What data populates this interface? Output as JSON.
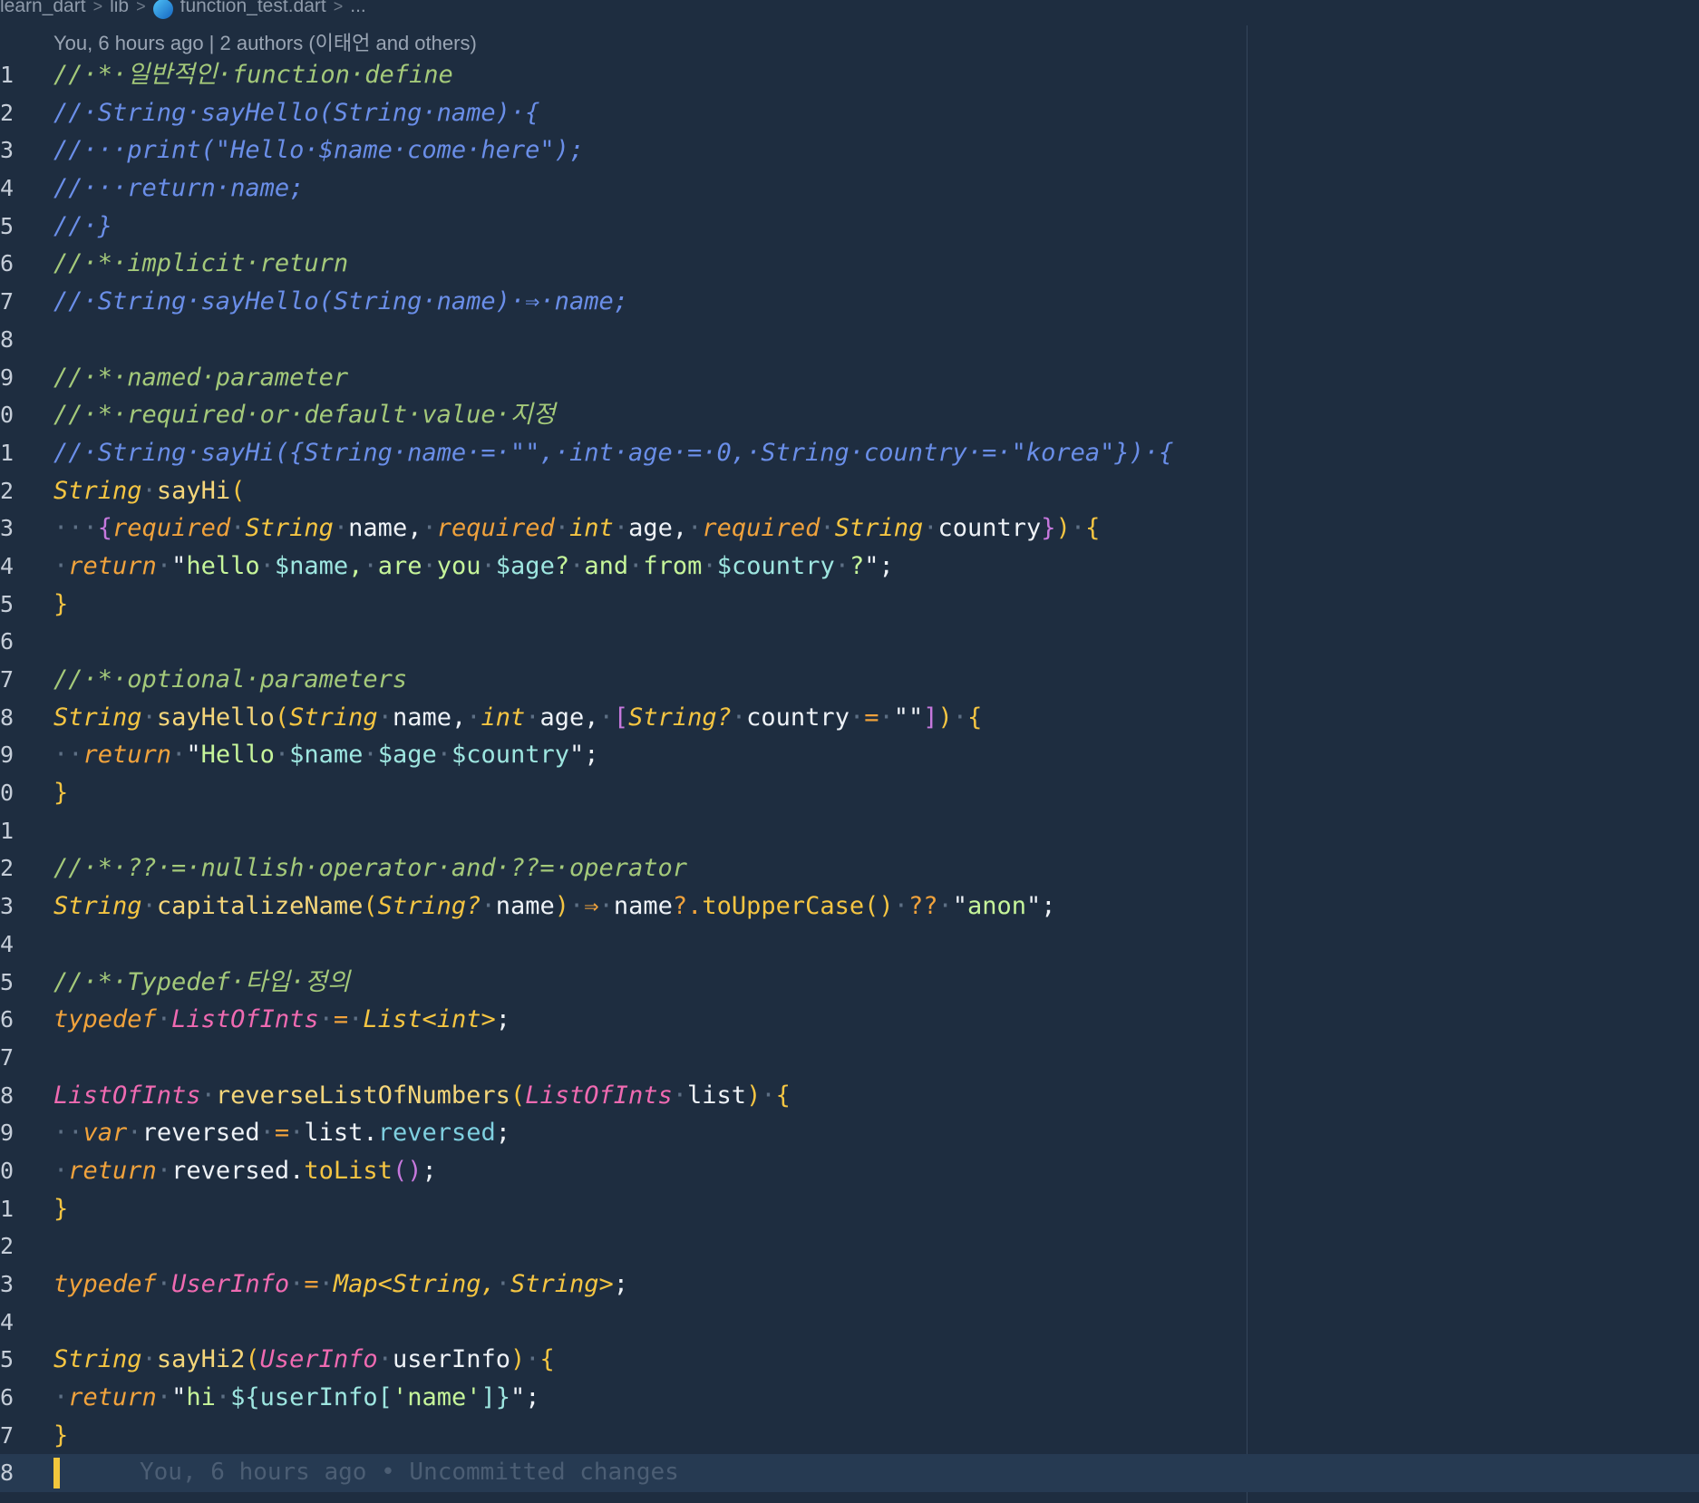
{
  "breadcrumb": {
    "project": "learn_dart",
    "folder": "lib",
    "file": "function_test.dart",
    "more": "...",
    "file_icon": "dart-file-icon"
  },
  "codelens": "You, 6 hours ago | 2 authors (이태언 and others)",
  "current_line_blame": "You, 6 hours ago • Uncommitted changes",
  "colors": {
    "background": "#1e2d40",
    "comment": "#a4c97a",
    "commented_code": "#6a8ee8",
    "type": "#f5c542",
    "keyword": "#f0a23c",
    "string": "#c6f59a",
    "alias": "#ef6ab1",
    "cursor": "#f2c73c"
  },
  "lines": [
    {
      "n": "1",
      "segs": [
        [
          "c",
          "//·*·일반적인·function·define"
        ]
      ]
    },
    {
      "n": "2",
      "segs": [
        [
          "cb",
          "//·String·sayHello(String·name)·{"
        ]
      ]
    },
    {
      "n": "3",
      "segs": [
        [
          "cb",
          "//···print(\"Hello·$name·come·here\");"
        ]
      ]
    },
    {
      "n": "4",
      "segs": [
        [
          "cb",
          "//···return·name;"
        ]
      ]
    },
    {
      "n": "5",
      "segs": [
        [
          "cb",
          "//·}"
        ]
      ]
    },
    {
      "n": "6",
      "segs": [
        [
          "c",
          "//·*·implicit·return"
        ]
      ]
    },
    {
      "n": "7",
      "segs": [
        [
          "cb",
          "//·String·sayHello(String·name)·⇒·name;"
        ]
      ]
    },
    {
      "n": "8",
      "segs": []
    },
    {
      "n": "9",
      "segs": [
        [
          "c",
          "//·*·named·parameter"
        ]
      ]
    },
    {
      "n": "0",
      "segs": [
        [
          "c",
          "//·*·required·or·default·value·지정"
        ]
      ]
    },
    {
      "n": "1",
      "segs": [
        [
          "cb",
          "//·String·sayHi({String·name·=·\"\",·int·age·=·0,·String·country·=·\"korea\"})·{"
        ]
      ]
    },
    {
      "n": "2",
      "segs": [
        [
          "ty",
          "String"
        ],
        [
          "ws",
          "·"
        ],
        [
          "fn",
          "sayHi"
        ],
        [
          "pu",
          "("
        ]
      ]
    },
    {
      "n": "3",
      "segs": [
        [
          "ws",
          "···"
        ],
        [
          "pk",
          "{"
        ],
        [
          "kw",
          "required"
        ],
        [
          "ws",
          "·"
        ],
        [
          "ty",
          "String"
        ],
        [
          "ws",
          "·"
        ],
        [
          "id",
          "name,"
        ],
        [
          "ws",
          "·"
        ],
        [
          "kw",
          "required"
        ],
        [
          "ws",
          "·"
        ],
        [
          "ty",
          "int"
        ],
        [
          "ws",
          "·"
        ],
        [
          "id",
          "age,"
        ],
        [
          "ws",
          "·"
        ],
        [
          "kw",
          "required"
        ],
        [
          "ws",
          "·"
        ],
        [
          "ty",
          "String"
        ],
        [
          "ws",
          "·"
        ],
        [
          "id",
          "country"
        ],
        [
          "pk",
          "}"
        ],
        [
          "pu",
          ")"
        ],
        [
          "ws",
          "·"
        ],
        [
          "pu",
          "{"
        ]
      ]
    },
    {
      "n": "4",
      "segs": [
        [
          "ws",
          "·"
        ],
        [
          "kw",
          "return"
        ],
        [
          "ws",
          "·"
        ],
        [
          "id",
          "\""
        ],
        [
          "st",
          "hello"
        ],
        [
          "ws",
          "·"
        ],
        [
          "iv",
          "$name"
        ],
        [
          "st",
          ","
        ],
        [
          "ws",
          "·"
        ],
        [
          "st",
          "are"
        ],
        [
          "ws",
          "·"
        ],
        [
          "st",
          "you"
        ],
        [
          "ws",
          "·"
        ],
        [
          "iv",
          "$age"
        ],
        [
          "st",
          "?"
        ],
        [
          "ws",
          "·"
        ],
        [
          "st",
          "and"
        ],
        [
          "ws",
          "·"
        ],
        [
          "st",
          "from"
        ],
        [
          "ws",
          "·"
        ],
        [
          "iv",
          "$country"
        ],
        [
          "ws",
          "·"
        ],
        [
          "st",
          "?"
        ],
        [
          "id",
          "\";"
        ]
      ]
    },
    {
      "n": "5",
      "segs": [
        [
          "pu",
          "}"
        ]
      ]
    },
    {
      "n": "6",
      "segs": []
    },
    {
      "n": "7",
      "segs": [
        [
          "c",
          "//·*·optional·parameters"
        ]
      ]
    },
    {
      "n": "8",
      "segs": [
        [
          "ty",
          "String"
        ],
        [
          "ws",
          "·"
        ],
        [
          "fn",
          "sayHello"
        ],
        [
          "pu",
          "("
        ],
        [
          "ty",
          "String"
        ],
        [
          "ws",
          "·"
        ],
        [
          "id",
          "name,"
        ],
        [
          "ws",
          "·"
        ],
        [
          "ty",
          "int"
        ],
        [
          "ws",
          "·"
        ],
        [
          "id",
          "age,"
        ],
        [
          "ws",
          "·"
        ],
        [
          "pk",
          "["
        ],
        [
          "ty",
          "String?"
        ],
        [
          "ws",
          "·"
        ],
        [
          "id",
          "country"
        ],
        [
          "ws",
          "·"
        ],
        [
          "op",
          "="
        ],
        [
          "ws",
          "·"
        ],
        [
          "id",
          "\"\""
        ],
        [
          "pk",
          "]"
        ],
        [
          "pu",
          ")"
        ],
        [
          "ws",
          "·"
        ],
        [
          "pu",
          "{"
        ]
      ]
    },
    {
      "n": "9",
      "segs": [
        [
          "ws",
          "··"
        ],
        [
          "kw",
          "return"
        ],
        [
          "ws",
          "·"
        ],
        [
          "id",
          "\""
        ],
        [
          "st",
          "Hello"
        ],
        [
          "ws",
          "·"
        ],
        [
          "iv",
          "$name"
        ],
        [
          "ws",
          "·"
        ],
        [
          "iv",
          "$age"
        ],
        [
          "ws",
          "·"
        ],
        [
          "iv",
          "$country"
        ],
        [
          "id",
          "\";"
        ]
      ]
    },
    {
      "n": "0",
      "segs": [
        [
          "pu",
          "}"
        ]
      ]
    },
    {
      "n": "1",
      "segs": []
    },
    {
      "n": "2",
      "segs": [
        [
          "c",
          "//·*·??·=·nullish·operator·and·??=·operator"
        ]
      ]
    },
    {
      "n": "3",
      "segs": [
        [
          "ty",
          "String"
        ],
        [
          "ws",
          "·"
        ],
        [
          "fn",
          "capitalizeName"
        ],
        [
          "pu",
          "("
        ],
        [
          "ty",
          "String?"
        ],
        [
          "ws",
          "·"
        ],
        [
          "id",
          "name"
        ],
        [
          "pu",
          ")"
        ],
        [
          "ws",
          "·"
        ],
        [
          "op",
          "⇒"
        ],
        [
          "ws",
          "·"
        ],
        [
          "id",
          "name"
        ],
        [
          "op",
          "?."
        ],
        [
          "mt",
          "toUpperCase"
        ],
        [
          "pu",
          "()"
        ],
        [
          "ws",
          "·"
        ],
        [
          "op",
          "??"
        ],
        [
          "ws",
          "·"
        ],
        [
          "id",
          "\""
        ],
        [
          "st",
          "anon"
        ],
        [
          "id",
          "\";"
        ]
      ]
    },
    {
      "n": "4",
      "segs": []
    },
    {
      "n": "5",
      "segs": [
        [
          "c",
          "//·*·Typedef·타입·정의"
        ]
      ]
    },
    {
      "n": "6",
      "segs": [
        [
          "kw",
          "typedef"
        ],
        [
          "ws",
          "·"
        ],
        [
          "al",
          "ListOfInts"
        ],
        [
          "ws",
          "·"
        ],
        [
          "op",
          "="
        ],
        [
          "ws",
          "·"
        ],
        [
          "ty",
          "List<int>"
        ],
        [
          "id",
          ";"
        ]
      ]
    },
    {
      "n": "7",
      "segs": []
    },
    {
      "n": "8",
      "segs": [
        [
          "al",
          "ListOfInts"
        ],
        [
          "ws",
          "·"
        ],
        [
          "fn",
          "reverseListOfNumbers"
        ],
        [
          "pu",
          "("
        ],
        [
          "al",
          "ListOfInts"
        ],
        [
          "ws",
          "·"
        ],
        [
          "id",
          "list"
        ],
        [
          "pu",
          ")"
        ],
        [
          "ws",
          "·"
        ],
        [
          "pu",
          "{"
        ]
      ]
    },
    {
      "n": "9",
      "segs": [
        [
          "ws",
          "··"
        ],
        [
          "kw",
          "var"
        ],
        [
          "ws",
          "·"
        ],
        [
          "id",
          "reversed"
        ],
        [
          "ws",
          "·"
        ],
        [
          "op",
          "="
        ],
        [
          "ws",
          "·"
        ],
        [
          "id",
          "list."
        ],
        [
          "pr",
          "reversed"
        ],
        [
          "id",
          ";"
        ]
      ]
    },
    {
      "n": "0",
      "segs": [
        [
          "ws",
          "·"
        ],
        [
          "kw",
          "return"
        ],
        [
          "ws",
          "·"
        ],
        [
          "id",
          "reversed."
        ],
        [
          "mt",
          "toList"
        ],
        [
          "pk",
          "()"
        ],
        [
          "id",
          ";"
        ]
      ]
    },
    {
      "n": "1",
      "segs": [
        [
          "pu",
          "}"
        ]
      ]
    },
    {
      "n": "2",
      "segs": []
    },
    {
      "n": "3",
      "segs": [
        [
          "kw",
          "typedef"
        ],
        [
          "ws",
          "·"
        ],
        [
          "al",
          "UserInfo"
        ],
        [
          "ws",
          "·"
        ],
        [
          "op",
          "="
        ],
        [
          "ws",
          "·"
        ],
        [
          "ty",
          "Map<String,"
        ],
        [
          "ws",
          "·"
        ],
        [
          "ty",
          "String>"
        ],
        [
          "id",
          ";"
        ]
      ]
    },
    {
      "n": "4",
      "segs": []
    },
    {
      "n": "5",
      "segs": [
        [
          "ty",
          "String"
        ],
        [
          "ws",
          "·"
        ],
        [
          "fn",
          "sayHi2"
        ],
        [
          "pu",
          "("
        ],
        [
          "al",
          "UserInfo"
        ],
        [
          "ws",
          "·"
        ],
        [
          "id",
          "userInfo"
        ],
        [
          "pu",
          ")"
        ],
        [
          "ws",
          "·"
        ],
        [
          "pu",
          "{"
        ]
      ]
    },
    {
      "n": "6",
      "segs": [
        [
          "ws",
          "·"
        ],
        [
          "kw",
          "return"
        ],
        [
          "ws",
          "·"
        ],
        [
          "id",
          "\""
        ],
        [
          "st",
          "hi"
        ],
        [
          "ws",
          "·"
        ],
        [
          "iv",
          "${userInfo["
        ],
        [
          "st",
          "'name'"
        ],
        [
          "iv",
          "]}"
        ],
        [
          "id",
          "\";"
        ]
      ]
    },
    {
      "n": "7",
      "segs": [
        [
          "pu",
          "}"
        ]
      ]
    },
    {
      "n": "8",
      "segs": [],
      "current": true
    }
  ]
}
